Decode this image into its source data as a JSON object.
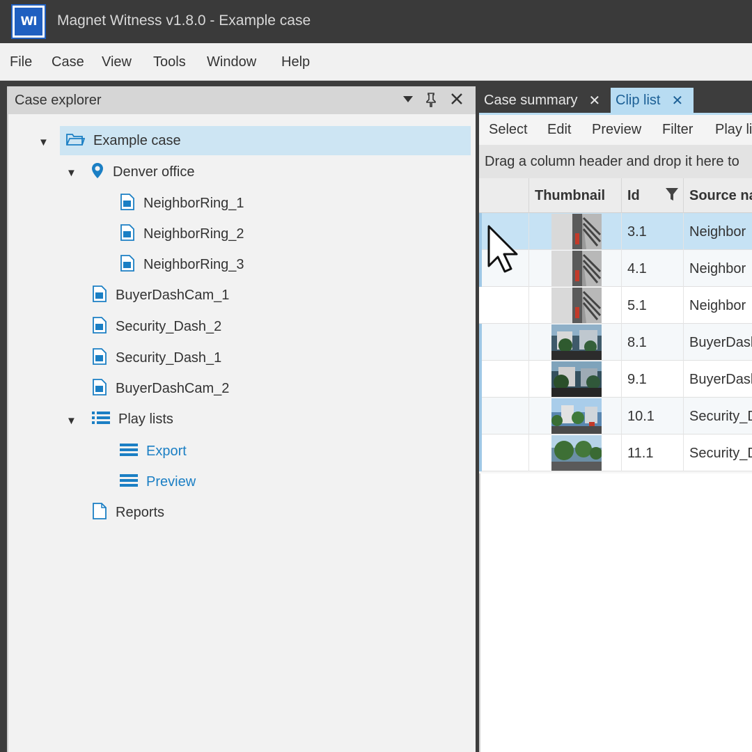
{
  "app": {
    "logo_text": "WI",
    "title": "Magnet Witness v1.8.0 - Example case"
  },
  "menu": [
    "File",
    "Case",
    "View",
    "Tools",
    "Window",
    "Help"
  ],
  "case_explorer": {
    "title": "Case explorer",
    "tree": {
      "root": "Example case",
      "location": "Denver office",
      "location_items": [
        "NeighborRing_1",
        "NeighborRing_2",
        "NeighborRing_3"
      ],
      "files": [
        "BuyerDashCam_1",
        "Security_Dash_2",
        "Security_Dash_1",
        "BuyerDashCam_2"
      ],
      "playlists": "Play lists",
      "playlist_items": [
        "Export",
        "Preview"
      ],
      "reports": "Reports"
    }
  },
  "tabs": [
    {
      "label": "Case summary",
      "active": false
    },
    {
      "label": "Clip list",
      "active": true
    }
  ],
  "toolbar": [
    "Select",
    "Edit",
    "Preview",
    "Filter",
    "Play li"
  ],
  "group_hint": "Drag a column header and drop it here to",
  "grid": {
    "columns": [
      "Thumbnail",
      "Id",
      "Source na"
    ],
    "rows": [
      {
        "id": "3.1",
        "source": "Neighbor",
        "thumb": "gray"
      },
      {
        "id": "4.1",
        "source": "Neighbor",
        "thumb": "gray"
      },
      {
        "id": "5.1",
        "source": "Neighbor",
        "thumb": "gray"
      },
      {
        "id": "8.1",
        "source": "BuyerDasl",
        "thumb": "street-dark"
      },
      {
        "id": "9.1",
        "source": "BuyerDasl",
        "thumb": "street-dark"
      },
      {
        "id": "10.1",
        "source": "Security_D",
        "thumb": "street-blue"
      },
      {
        "id": "11.1",
        "source": "Security_D",
        "thumb": "street-green"
      }
    ]
  },
  "colors": {
    "accent": "#1b7fc4",
    "selection": "#cde5f3",
    "active_tab": "#b8dcf2",
    "titlebar": "#3a3a3a"
  }
}
